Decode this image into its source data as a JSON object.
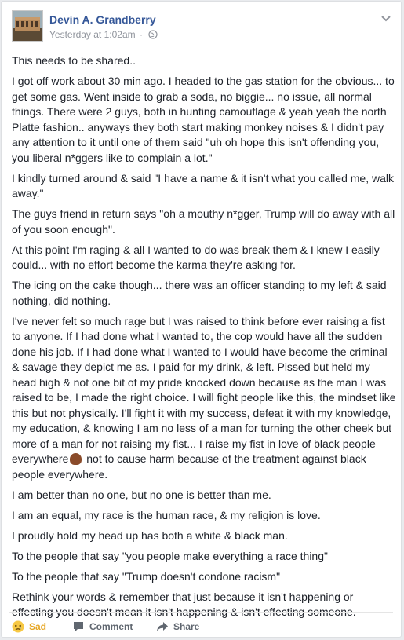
{
  "post": {
    "author": "Devin A. Grandberry",
    "timestamp": "Yesterday at 1:02am",
    "separator": "·",
    "privacy_icon": "globe-icon",
    "paragraphs": [
      "This needs to be shared..",
      "I got off work about 30 min ago. I headed to the gas station for the obvious... to get some gas. Went inside to grab a soda, no biggie... no issue, all normal things. There were 2 guys, both in hunting camouflage & yeah yeah the north Platte fashion.. anyways they both start making monkey noises & I didn't pay any attention to it until one of them said \"uh oh hope this isn't offending you, you liberal n*ggers like to complain a lot.\"",
      "I kindly turned around & said \"I have a name & it isn't what you called me, walk away.\"",
      "The guys friend in return says \"oh a mouthy n*gger, Trump will do away with all of you soon enough\".",
      "At this point I'm raging & all I wanted to do was break them & I knew I easily could... with no effort become the karma they're asking for.",
      "The icing on the cake though... there was an officer standing to my left & said nothing, did nothing."
    ],
    "long_paragraph_before_emoji": "I've never felt so much rage but I was raised to think before ever raising a fist to anyone. If I had done what I wanted to, the cop would have all the sudden done his job. If I had done what I wanted to I would have become the criminal & savage they depict me as. I paid for my drink, & left. Pissed but held my head high & not one bit of my pride knocked down because as the man I was raised to be, I made the right choice. I will fight people like this, the mindset like this but not physically. I'll fight it with my success, defeat it with my knowledge, my education, & knowing I am no less of a man for turning the other cheek but more of a man for not raising my fist... I raise my fist in love of black people everywhere",
    "emoji_icon": "raised-fist-icon",
    "long_paragraph_after_emoji": " not to cause harm because of the treatment against black people everywhere.",
    "closing_paragraphs": [
      "I am better than no one, but no one is better than me.",
      "I am an equal, my race is the human race, & my religion is love.",
      "I proudly hold my head up has both a white & black man.",
      "To the people that say \"you people make everything a race thing\"",
      "To the people that say \"Trump doesn't condone racism\"",
      "Rethink your words & remember that just because it isn't happening or effecting you doesn't mean it isn't happening & isn't effecting someone."
    ]
  },
  "actions": {
    "reaction_label": "Sad",
    "comment_label": "Comment",
    "share_label": "Share"
  },
  "colors": {
    "author": "#365899",
    "text": "#1d2129",
    "meta": "#90949c",
    "sad": "#e6a623"
  }
}
